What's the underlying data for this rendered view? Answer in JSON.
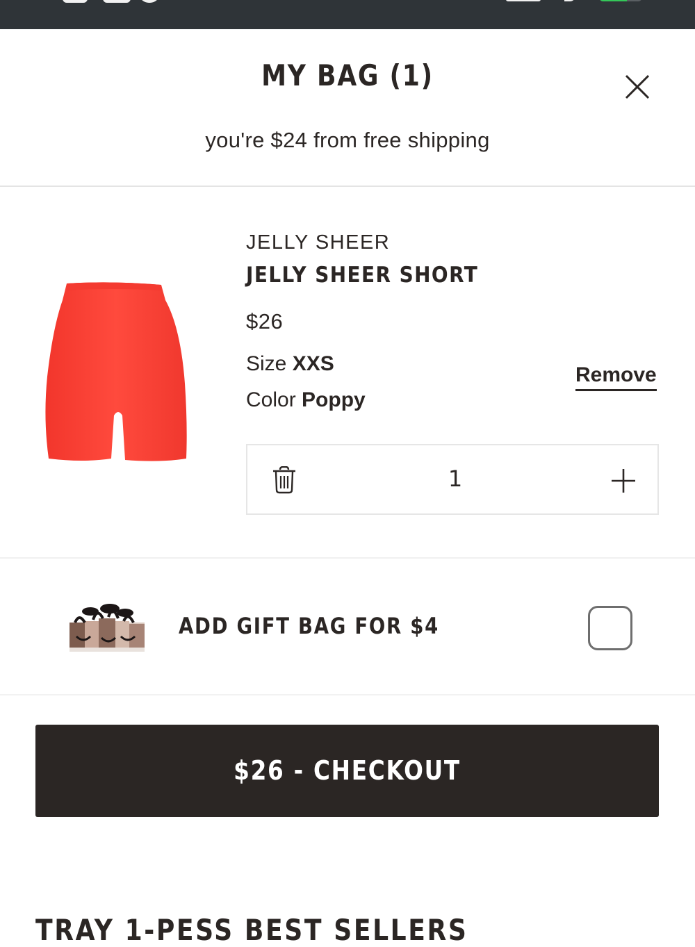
{
  "status_bar": {
    "battery_level": 0.65,
    "battery_color": "#34c759"
  },
  "header": {
    "title": "MY BAG (1)",
    "close_icon": "close-icon",
    "shipping_message": "you're $24 from free shipping"
  },
  "cart_item": {
    "brand": "JELLY SHEER",
    "name": "JELLY SHEER SHORT",
    "price": "$26",
    "size_label": "Size",
    "size_value": "XXS",
    "color_label": "Color",
    "color_value": "Poppy",
    "product_color": "#fb3f34",
    "remove_label": "Remove",
    "quantity": "1",
    "trash_icon": "trash-icon",
    "plus_icon": "plus-icon"
  },
  "gift_bag": {
    "label": "ADD GIFT BAG FOR $4",
    "checked": false
  },
  "checkout": {
    "label": "$26 - CHECKOUT",
    "background": "#2b2624"
  },
  "recommendations": {
    "heading": "TRAY 1-PESS BEST SELLERS"
  }
}
